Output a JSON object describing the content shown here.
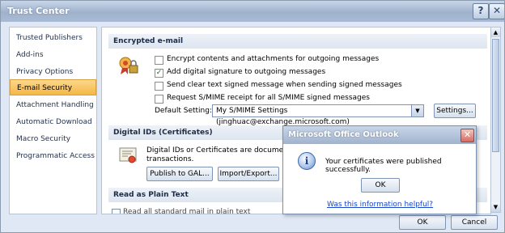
{
  "window": {
    "title": "Trust Center",
    "help_glyph": "?",
    "close_glyph": "✕"
  },
  "nav": {
    "items": [
      {
        "label": "Trusted Publishers"
      },
      {
        "label": "Add-ins"
      },
      {
        "label": "Privacy Options"
      },
      {
        "label": "E-mail Security",
        "selected": true
      },
      {
        "label": "Attachment Handling"
      },
      {
        "label": "Automatic Download"
      },
      {
        "label": "Macro Security"
      },
      {
        "label": "Programmatic Access"
      }
    ]
  },
  "encrypted": {
    "heading": "Encrypted e-mail",
    "options": [
      {
        "label": "Encrypt contents and attachments for outgoing messages",
        "checked": false
      },
      {
        "label": "Add digital signature to outgoing messages",
        "checked": true
      },
      {
        "label": "Send clear text signed message when sending signed messages",
        "checked": false
      },
      {
        "label": "Request S/MIME receipt for all S/MIME signed messages",
        "checked": false
      }
    ],
    "default_setting_label": "Default Setting:",
    "default_setting_value": "My S/MIME Settings (jinghuac@exchange.microsoft.com)",
    "settings_button": "Settings..."
  },
  "digital_ids": {
    "heading": "Digital IDs (Certificates)",
    "text_line1": "Digital IDs or Certificates are documents th",
    "text_line2": "transactions.",
    "publish_button": "Publish to GAL...",
    "import_button": "Import/Export...",
    "partial_button": ""
  },
  "plain_text": {
    "heading": "Read as Plain Text",
    "partial_text": "Read all standard mail in plain text"
  },
  "footer": {
    "ok": "OK",
    "cancel": "Cancel"
  },
  "dialog": {
    "title": "Microsoft Office Outlook",
    "close_glyph": "✕",
    "message": "Your certificates were published successfully.",
    "ok": "OK",
    "help_link": "Was this information helpful?",
    "icon_glyph": "i"
  },
  "scroll_up_glyph": "▲",
  "scroll_down_glyph": "▼",
  "dropdown_glyph": "▼",
  "check_glyph": "✓"
}
